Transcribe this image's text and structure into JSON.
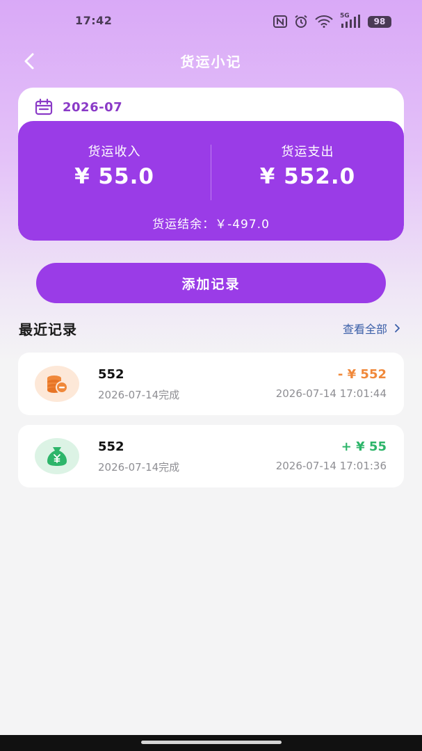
{
  "status_bar": {
    "time": "17:42",
    "network": "5G",
    "battery": "98"
  },
  "header": {
    "title": "货运小记"
  },
  "summary": {
    "month": "2026-07",
    "income_label": "货运收入",
    "income_value": "¥ 55.0",
    "expense_label": "货运支出",
    "expense_value": "¥ 552.0",
    "balance_text": "货运结余：￥-497.0"
  },
  "add_button": {
    "label": "添加记录"
  },
  "recent": {
    "title": "最近记录",
    "view_all": "查看全部",
    "records": [
      {
        "name": "552",
        "status": "2026-07-14完成",
        "amount": "- ¥ 552",
        "time": "2026-07-14 17:01:44",
        "type": "expense"
      },
      {
        "name": "552",
        "status": "2026-07-14完成",
        "amount": "+ ¥ 55",
        "time": "2026-07-14 17:01:36",
        "type": "income"
      }
    ]
  },
  "colors": {
    "accent": "#9a3ce7",
    "expense": "#f0883a",
    "income": "#2db56a",
    "link": "#3b5fa8"
  }
}
